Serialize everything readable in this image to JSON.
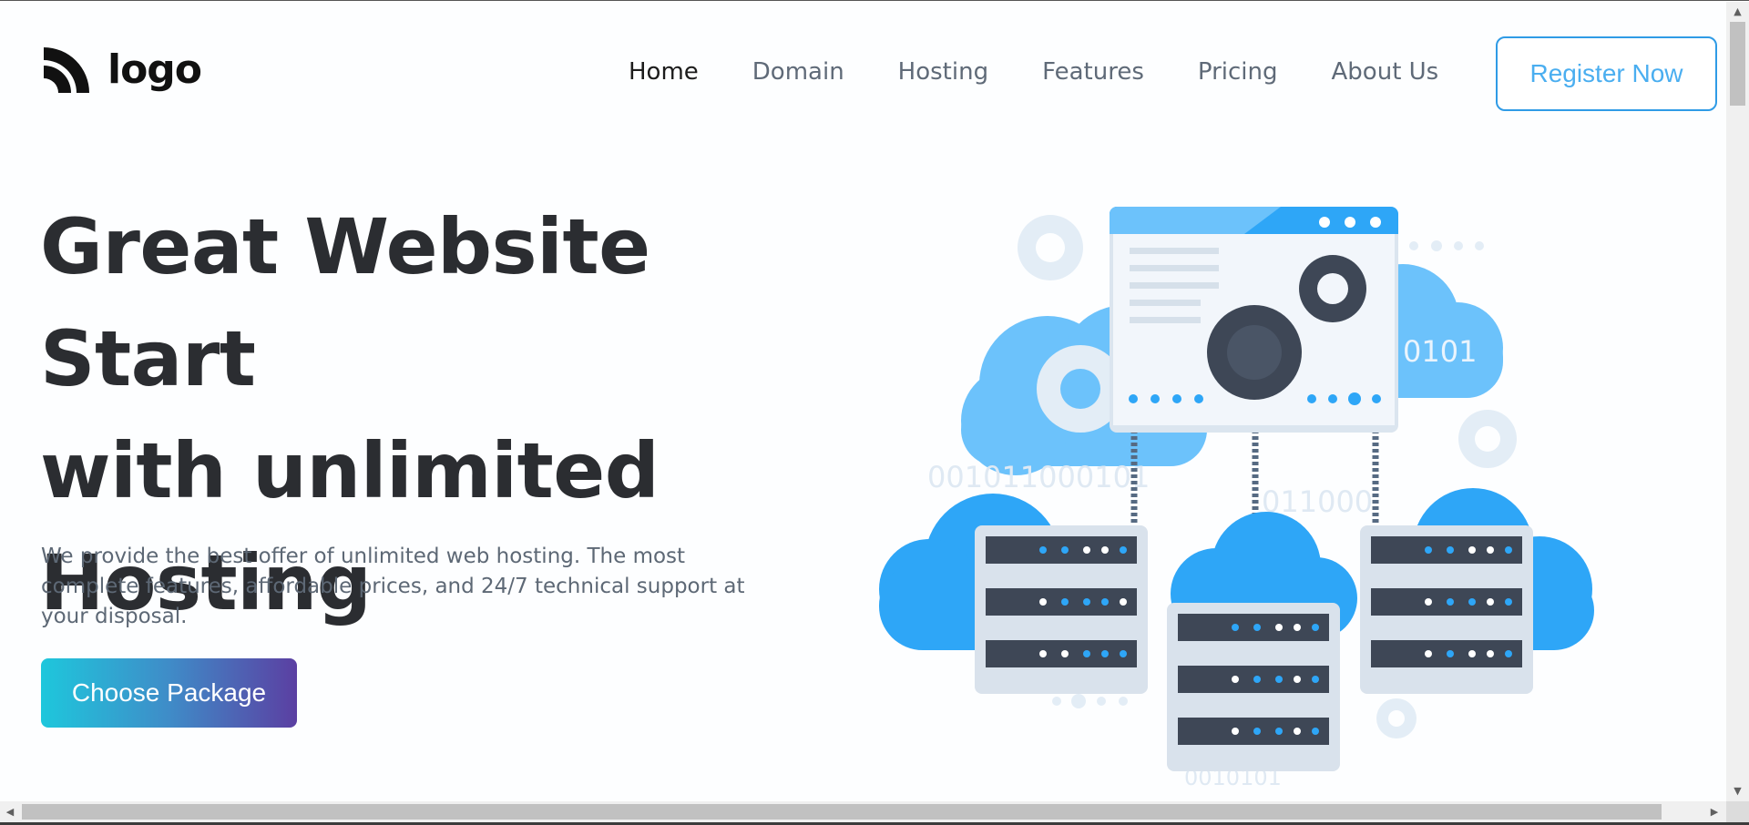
{
  "brand": {
    "logo_text": "logo"
  },
  "nav": {
    "items": [
      {
        "label": "Home",
        "active": true
      },
      {
        "label": "Domain",
        "active": false
      },
      {
        "label": "Hosting",
        "active": false
      },
      {
        "label": "Features",
        "active": false
      },
      {
        "label": "Pricing",
        "active": false
      },
      {
        "label": "About Us",
        "active": false
      }
    ],
    "register_label": "Register Now"
  },
  "hero": {
    "title_line1": "Great Website Start",
    "title_line2": "with unlimited",
    "title_line3": "Hosting",
    "description": "We provide the best offer of unlimited web hosting. The most complete features, affordable prices, and 24/7 technical support at your disposal.",
    "cta_label": "Choose Package"
  },
  "illustration": {
    "binary_1": "0101",
    "binary_2": "001011000101",
    "binary_3": "011000",
    "binary_4": "0010101"
  },
  "colors": {
    "accent_blue": "#2f9be6",
    "cloud_light": "#6cc2fb",
    "cloud_dark": "#2ea6f7",
    "server_dark": "#3e4756",
    "cta_gradient_start": "#1ec7dc",
    "cta_gradient_end": "#5b3fa2"
  },
  "icons": [
    "logo-icon",
    "gear-icon",
    "server-icon",
    "cloud-icon"
  ]
}
